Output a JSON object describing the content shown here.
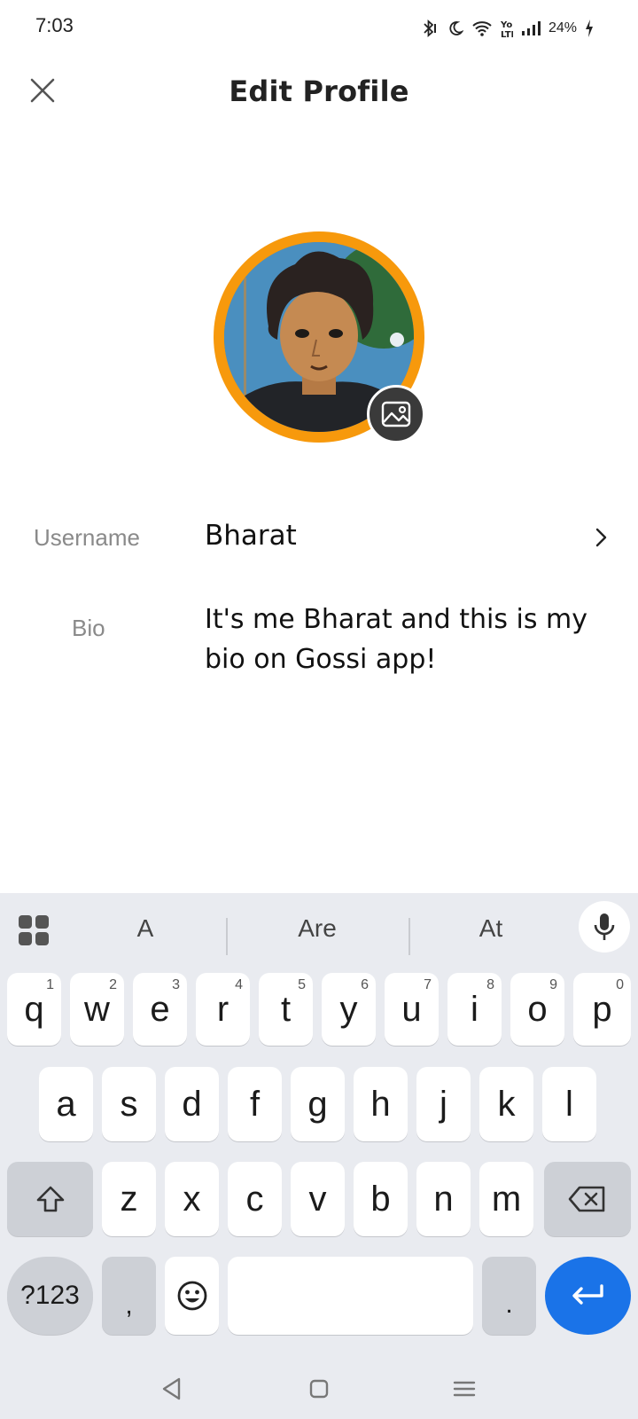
{
  "status_bar": {
    "time": "7:03",
    "battery": "24%",
    "icons": [
      "bluetooth-icon",
      "moon-icon",
      "wifi-icon",
      "volte-icon",
      "signal-icon",
      "charging-icon"
    ]
  },
  "header": {
    "title": "Edit Profile",
    "close_icon": "close-icon"
  },
  "profile": {
    "avatar_ring_color": "#f7990c",
    "edit_photo_icon": "image-icon"
  },
  "fields": {
    "username_label": "Username",
    "username_value": "Bharat",
    "bio_label": "Bio",
    "bio_value": "It's me Bharat and this is my bio on Gossi app!"
  },
  "keyboard": {
    "suggestions": [
      "A",
      "Are",
      "At"
    ],
    "row1": [
      {
        "key": "q",
        "hint": "1"
      },
      {
        "key": "w",
        "hint": "2"
      },
      {
        "key": "e",
        "hint": "3"
      },
      {
        "key": "r",
        "hint": "4"
      },
      {
        "key": "t",
        "hint": "5"
      },
      {
        "key": "y",
        "hint": "6"
      },
      {
        "key": "u",
        "hint": "7"
      },
      {
        "key": "i",
        "hint": "8"
      },
      {
        "key": "o",
        "hint": "9"
      },
      {
        "key": "p",
        "hint": "0"
      }
    ],
    "row2": [
      "a",
      "s",
      "d",
      "f",
      "g",
      "h",
      "j",
      "k",
      "l"
    ],
    "row3": [
      "z",
      "x",
      "c",
      "v",
      "b",
      "n",
      "m"
    ],
    "symbols_label": "?123",
    "comma_label": ",",
    "period_label": ".",
    "accent_color": "#1a73e8"
  }
}
